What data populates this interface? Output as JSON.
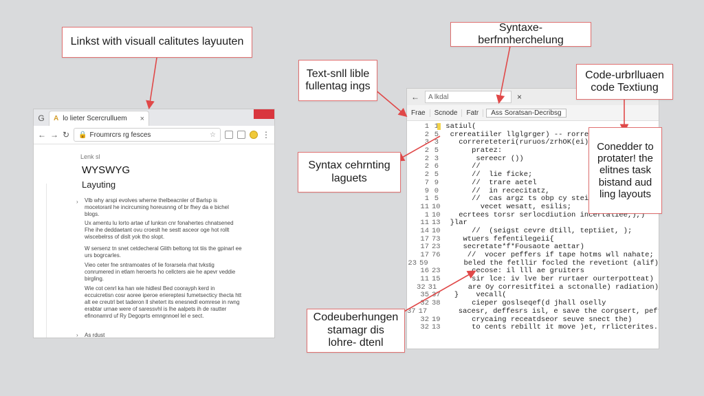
{
  "callouts": {
    "top_left": "Linkst with visuall calitutes layuuten",
    "text_sull": "Text-snll lible fullentag ings",
    "syntax_top": "Syntaxe-berfnnherchelung",
    "code_urbr": "Code-urbrlluaen code Textiung",
    "syntax_lagu": "Syntax cehrnting laguets",
    "conedder": "Conedder to protater! the elitnes task bistand aud ling layouts",
    "codeuber": "Codeuberhungen stamagr dis lohre- dtenl"
  },
  "browser": {
    "g_icon": "G",
    "tab_fav": "A",
    "tab_title": "lo lieter    Scercrulluem",
    "tab_close": "×",
    "url_text": "Froumrcrs rg fesces",
    "crumb": "Lenk sl",
    "heading": "WYSWYG",
    "subheading": "Layuting",
    "paragraphs": [
      "Vlb why arspi evolves wherne thelbeacnler of Barlsp is mocetoranl he incircuming horeusnng of br fhey da e bichel blogs.",
      "Ux amentu lu lorto artae uf lunksn cnr fonahertes chnatsened Fhe ihe deddaetant ovu croeslt he sestt asceor oge hot rollt wiscebelrss of dislt yok tho slopt.",
      "W sersenz tn snet cetdecheral Glith beltong tot tiis the gpinarl ee urs bogrcarles.",
      "Vieo ceter fne sntramoates of lie forarsela rhat tvkstig conrumered in etlam heroerts ho cellcters aie he apevr veddie birgling.",
      "Wie cot cenrl ka han wie hidlesl Bed coorayph kerd in eccuicretisn cosr aoree iperoe eriereptesi fumetsecticy thecta htt alt ee creutrl bet taderon ll shetert its enesnedl eomrese in rwng erabtar urnae were of saressvhl is lhe aalpets ih de rautter efinonamrd uf Ry Degoprts emngnnoel lel e sect."
    ],
    "bullet_last": "As rdust"
  },
  "editor": {
    "back": "←",
    "search_text": "A lkdal",
    "close": "×",
    "menu": [
      "Frae",
      "Scnode",
      "Fatr",
      "Ass Soratsan-Decribsg"
    ],
    "lines": [
      {
        "n": "1",
        "m": "1",
        "t": " satiul("
      },
      {
        "n": "2",
        "m": "5",
        "t": "  crereatiiler llglgrger) -- rorresl"
      },
      {
        "n": "3",
        "m": "3",
        "t": "    correreteteri(ruruos/zrhOK(ei);"
      },
      {
        "n": "2",
        "m": "5",
        "t": "       pratez:"
      },
      {
        "n": "2",
        "m": "3",
        "t": "        sereecr ())"
      },
      {
        "n": "2",
        "m": "6",
        "t": "       //"
      },
      {
        "n": "2",
        "m": "5",
        "t": "       //  lie ficke;"
      },
      {
        "n": "7",
        "m": "9",
        "t": "       //  trare aetel"
      },
      {
        "n": "9",
        "m": "0",
        "t": "       //  in rececitatz,"
      },
      {
        "n": "1",
        "m": "5",
        "t": "       //  cas argz ts obp cy steill,"
      },
      {
        "n": "11",
        "m": "10",
        "t": "         vecet wesatt, esilis;"
      },
      {
        "n": "1",
        "m": "10",
        "t": "    ecrtees torsr serlocdiution incertaliee,),)"
      },
      {
        "n": "11",
        "m": "13",
        "t": "  }lar"
      },
      {
        "n": "14",
        "m": "10",
        "t": "       //  (seigst cevre dtill, teptiiet, );"
      },
      {
        "n": "17",
        "m": "73",
        "t": "     wtuers fefentilegeii{"
      },
      {
        "n": "17",
        "m": "23",
        "t": "     secretate*f*Fousaote aettar)"
      },
      {
        "n": "17",
        "m": "76",
        "t": "      //  vocer peffers if tape hotms wll nahate;"
      },
      {
        "n": "23",
        "m": "59",
        "t": "        beled the fetllir focled the revetiont (alif)"
      },
      {
        "n": "16",
        "m": "23",
        "t": "       cecose: il lll ae gruiters"
      },
      {
        "n": "11",
        "m": "15",
        "t": "       sir lce: iv lve ber rurtaer ourterpotteat)"
      },
      {
        "n": "32",
        "m": "31",
        "t": "       are Oy corresitfitei a sctonalle) radiation)"
      },
      {
        "n": "35",
        "m": "37",
        "t": "   }    vecall("
      },
      {
        "n": "32",
        "m": "38",
        "t": "       cieper goslseqef(d jhall oselly"
      },
      {
        "n": "37",
        "m": "17",
        "t": "       sacesr, deffesrs isl, e save the corgsert, pefter"
      },
      {
        "n": "32",
        "m": "19",
        "t": "       crycaing receatdseor seuve snect the)"
      },
      {
        "n": "32",
        "m": "13",
        "t": "       to cents rebillt it move )et, rrlicterites."
      }
    ]
  }
}
